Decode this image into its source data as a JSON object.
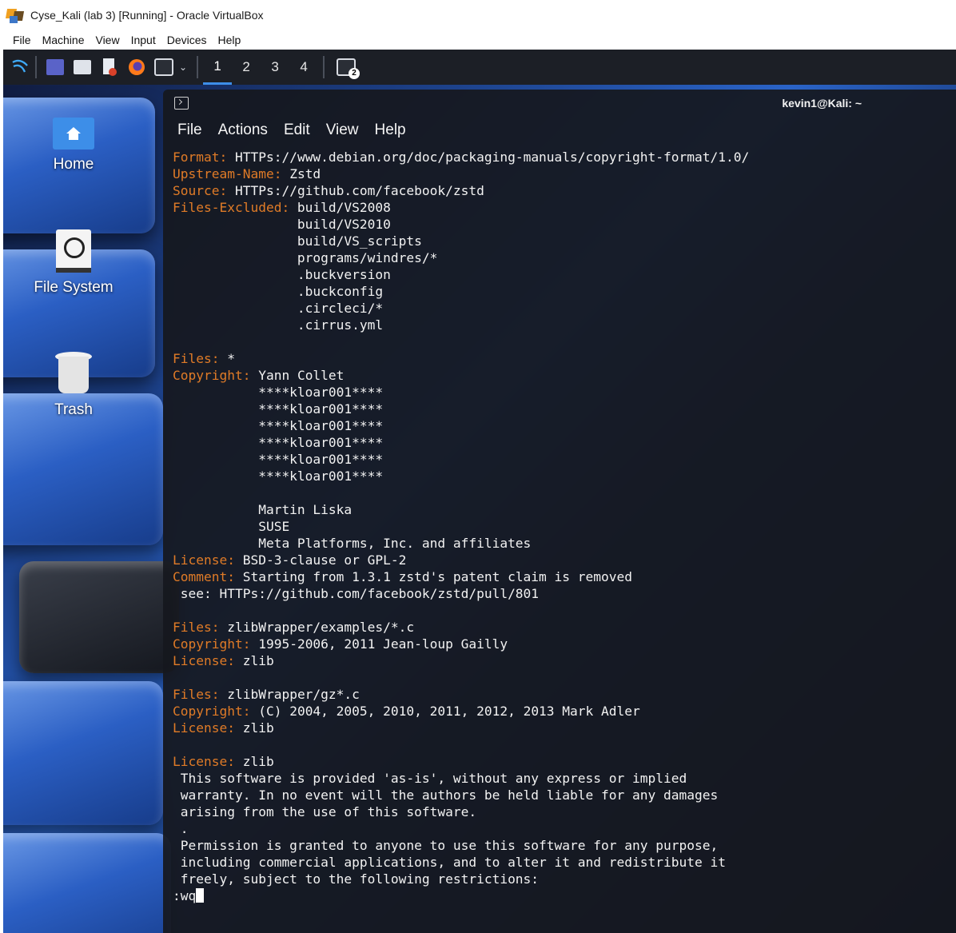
{
  "window": {
    "title": "Cyse_Kali (lab 3) [Running] - Oracle VirtualBox",
    "app_icon": "virtualbox-icon"
  },
  "vbox_menu": [
    "File",
    "Machine",
    "View",
    "Input",
    "Devices",
    "Help"
  ],
  "panel": {
    "workspaces": [
      "1",
      "2",
      "3",
      "4"
    ],
    "active_workspace": "1",
    "terminal_badge": "2"
  },
  "desktop_icons": [
    {
      "label": "Home",
      "icon": "home-folder-icon"
    },
    {
      "label": "File System",
      "icon": "drive-icon"
    },
    {
      "label": "Trash",
      "icon": "trash-icon"
    }
  ],
  "terminal": {
    "title": "kevin1@Kali: ~",
    "menu": [
      "File",
      "Actions",
      "Edit",
      "View",
      "Help"
    ],
    "lines": [
      {
        "k": "Format:",
        "v": " HTTPs://www.debian.org/doc/packaging-manuals/copyright-format/1.0/"
      },
      {
        "k": "Upstream-Name:",
        "v": " Zstd"
      },
      {
        "k": "Source:",
        "v": " HTTPs://github.com/facebook/zstd"
      },
      {
        "k": "Files-Excluded:",
        "v": " build/VS2008"
      },
      {
        "k": "",
        "v": "                build/VS2010"
      },
      {
        "k": "",
        "v": "                build/VS_scripts"
      },
      {
        "k": "",
        "v": "                programs/windres/*"
      },
      {
        "k": "",
        "v": "                .buckversion"
      },
      {
        "k": "",
        "v": "                .buckconfig"
      },
      {
        "k": "",
        "v": "                .circleci/*"
      },
      {
        "k": "",
        "v": "                .cirrus.yml"
      },
      {
        "k": "",
        "v": ""
      },
      {
        "k": "Files:",
        "v": " *"
      },
      {
        "k": "Copyright:",
        "v": " Yann Collet"
      },
      {
        "k": "",
        "v": "           ****kloar001****"
      },
      {
        "k": "",
        "v": "           ****kloar001****"
      },
      {
        "k": "",
        "v": "           ****kloar001****"
      },
      {
        "k": "",
        "v": "           ****kloar001****"
      },
      {
        "k": "",
        "v": "           ****kloar001****"
      },
      {
        "k": "",
        "v": "           ****kloar001****"
      },
      {
        "k": "",
        "v": ""
      },
      {
        "k": "",
        "v": "           Martin Liska"
      },
      {
        "k": "",
        "v": "           SUSE"
      },
      {
        "k": "",
        "v": "           Meta Platforms, Inc. and affiliates"
      },
      {
        "k": "License:",
        "v": " BSD-3-clause or GPL-2"
      },
      {
        "k": "Comment:",
        "v": " Starting from 1.3.1 zstd's patent claim is removed"
      },
      {
        "k": "",
        "v": " see: HTTPs://github.com/facebook/zstd/pull/801"
      },
      {
        "k": "",
        "v": ""
      },
      {
        "k": "Files:",
        "v": " zlibWrapper/examples/*.c"
      },
      {
        "k": "Copyright:",
        "v": " 1995-2006, 2011 Jean-loup Gailly"
      },
      {
        "k": "License:",
        "v": " zlib"
      },
      {
        "k": "",
        "v": ""
      },
      {
        "k": "Files:",
        "v": " zlibWrapper/gz*.c"
      },
      {
        "k": "Copyright:",
        "v": " (C) 2004, 2005, 2010, 2011, 2012, 2013 Mark Adler"
      },
      {
        "k": "License:",
        "v": " zlib"
      },
      {
        "k": "",
        "v": ""
      },
      {
        "k": "License:",
        "v": " zlib"
      },
      {
        "k": "",
        "v": " This software is provided 'as-is', without any express or implied"
      },
      {
        "k": "",
        "v": " warranty. In no event will the authors be held liable for any damages"
      },
      {
        "k": "",
        "v": " arising from the use of this software."
      },
      {
        "k": "",
        "v": " ."
      },
      {
        "k": "",
        "v": " Permission is granted to anyone to use this software for any purpose,"
      },
      {
        "k": "",
        "v": " including commercial applications, and to alter it and redistribute it"
      },
      {
        "k": "",
        "v": " freely, subject to the following restrictions:"
      }
    ],
    "command": ":wq"
  },
  "colors": {
    "key_highlight": "#e07b27",
    "terminal_bg": "#16181e",
    "panel_bg": "#1c1f26",
    "active_workspace": "#3d8ee8"
  }
}
